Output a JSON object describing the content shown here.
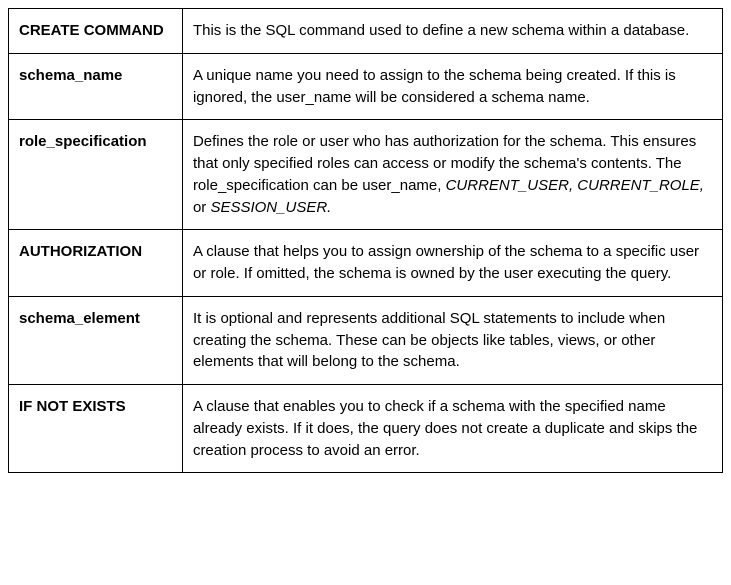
{
  "rows": [
    {
      "term": "CREATE COMMAND",
      "desc": "This is the SQL command used to define a new schema within a database."
    },
    {
      "term": "schema_name",
      "desc": "A unique name you need to assign to the schema being created. If this is ignored, the user_name will be considered a schema name."
    },
    {
      "term": "role_specification",
      "desc_pre": "Defines the role or user who has authorization for the schema. This ensures that only specified roles can access or modify the schema's contents. The role_specification can be user_name, ",
      "desc_italic": "CURRENT_USER, CURRENT_ROLE,",
      "desc_mid": " or ",
      "desc_italic2": "SESSION_USER.",
      "has_italic": true
    },
    {
      "term": "AUTHORIZATION",
      "desc": "A clause that helps you to assign ownership of the schema to a specific user or role. If omitted, the schema is owned by the user executing the query."
    },
    {
      "term": "schema_element",
      "desc": "It is optional and represents additional SQL statements to include when creating the schema. These can be objects like tables, views, or other elements that will belong to the schema."
    },
    {
      "term": "IF NOT EXISTS",
      "desc": "A clause that enables you to check if a schema with the specified name already exists. If it does, the query does not create a duplicate and skips the creation process to avoid an error."
    }
  ]
}
